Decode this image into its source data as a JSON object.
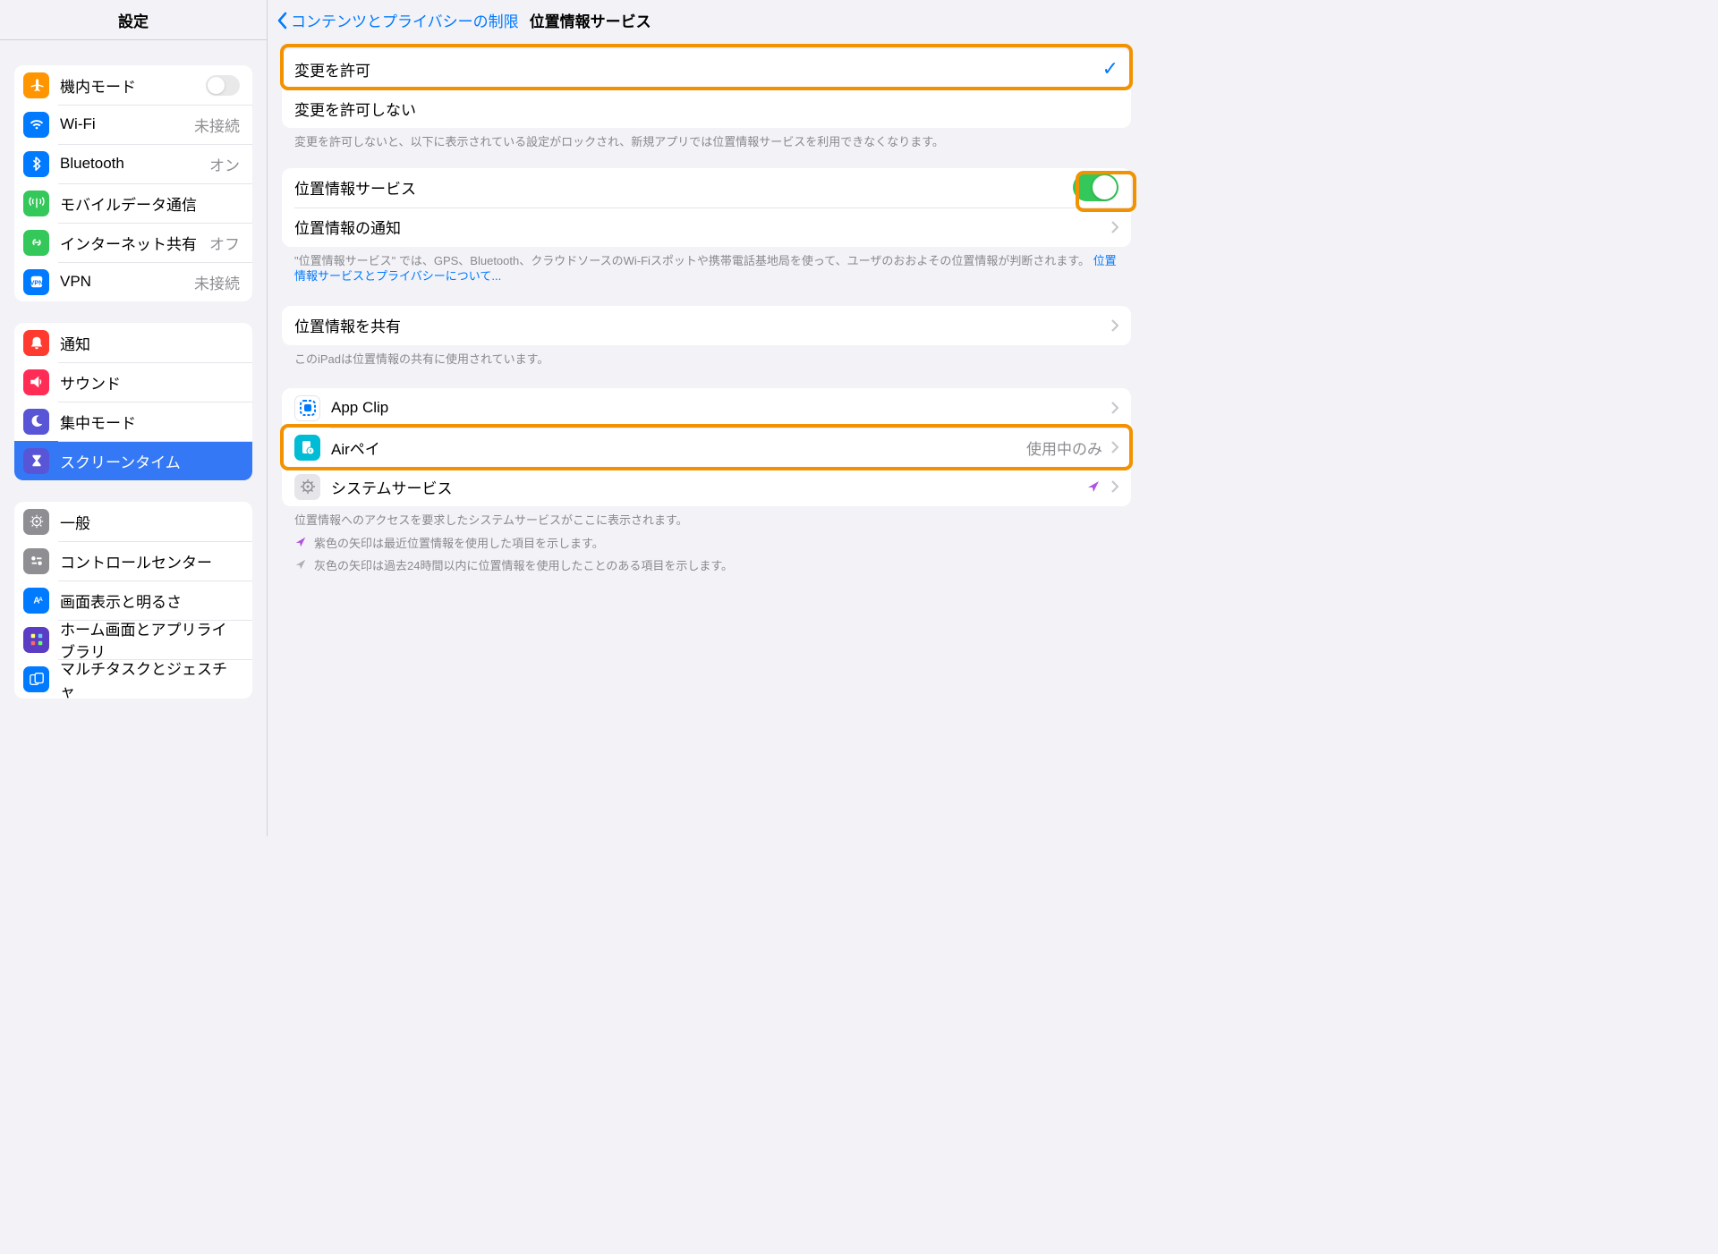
{
  "sidebar": {
    "title": "設定",
    "groups": [
      {
        "items": [
          {
            "icon": "airplane",
            "color": "#ff9500",
            "label": "機内モード",
            "accessory": "toggle-off"
          },
          {
            "icon": "wifi",
            "color": "#007aff",
            "label": "Wi-Fi",
            "value": "未接続"
          },
          {
            "icon": "bluetooth",
            "color": "#007aff",
            "label": "Bluetooth",
            "value": "オン"
          },
          {
            "icon": "antenna",
            "color": "#34c759",
            "label": "モバイルデータ通信"
          },
          {
            "icon": "link",
            "color": "#34c759",
            "label": "インターネット共有",
            "value": "オフ"
          },
          {
            "icon": "globe",
            "color": "#007aff",
            "label": "VPN",
            "value": "未接続"
          }
        ]
      },
      {
        "items": [
          {
            "icon": "bell",
            "color": "#ff3b30",
            "label": "通知"
          },
          {
            "icon": "speaker",
            "color": "#ff2d55",
            "label": "サウンド"
          },
          {
            "icon": "moon",
            "color": "#5856d6",
            "label": "集中モード"
          },
          {
            "icon": "hourglass",
            "color": "#5856d6",
            "label": "スクリーンタイム",
            "selected": true
          }
        ]
      },
      {
        "items": [
          {
            "icon": "gear",
            "color": "#8e8e93",
            "label": "一般"
          },
          {
            "icon": "switches",
            "color": "#8e8e93",
            "label": "コントロールセンター"
          },
          {
            "icon": "brightness",
            "color": "#007aff",
            "label": "画面表示と明るさ"
          },
          {
            "icon": "grid",
            "color": "#5b3cc4",
            "label": "ホーム画面とアプリライブラリ"
          },
          {
            "icon": "multitasking",
            "color": "#007aff",
            "label": "マルチタスクとジェスチャ"
          }
        ]
      }
    ]
  },
  "detail": {
    "back": "コンテンツとプライバシーの制限",
    "title": "位置情報サービス",
    "allow_group": {
      "items": [
        {
          "label": "変更を許可",
          "checked": true
        },
        {
          "label": "変更を許可しない",
          "checked": false
        }
      ],
      "footer": "変更を許可しないと、以下に表示されている設定がロックされ、新規アプリでは位置情報サービスを利用できなくなります。"
    },
    "location_group": {
      "items": [
        {
          "label": "位置情報サービス",
          "accessory": "toggle-on"
        },
        {
          "label": "位置情報の通知",
          "accessory": "chevron"
        }
      ],
      "footer_before_link": "\"位置情報サービス\" では、GPS、Bluetooth、クラウドソースのWi-Fiスポットや携帯電話基地局を使って、ユーザのおおよその位置情報が判断されます。 ",
      "footer_link": "位置情報サービスとプライバシーについて..."
    },
    "share_group": {
      "items": [
        {
          "label": "位置情報を共有",
          "accessory": "chevron"
        }
      ],
      "footer": "このiPadは位置情報の共有に使用されています。"
    },
    "apps_group": {
      "items": [
        {
          "icon": "appclip",
          "label": "App Clip",
          "accessory": "chevron"
        },
        {
          "icon": "airpay",
          "label": "Airペイ",
          "value": "使用中のみ",
          "accessory": "chevron"
        },
        {
          "icon": "sysservice",
          "label": "システムサービス",
          "indicator": "purple",
          "accessory": "chevron"
        }
      ],
      "footer": "位置情報へのアクセスを要求したシステムサービスがここに表示されます。",
      "legend": [
        {
          "color": "#af52de",
          "text": "紫色の矢印は最近位置情報を使用した項目を示します。"
        },
        {
          "color": "#aeaeb2",
          "text": "灰色の矢印は過去24時間以内に位置情報を使用したことのある項目を示します。"
        }
      ]
    }
  },
  "highlights": {
    "allow": true,
    "toggle": true,
    "airpay": true
  }
}
